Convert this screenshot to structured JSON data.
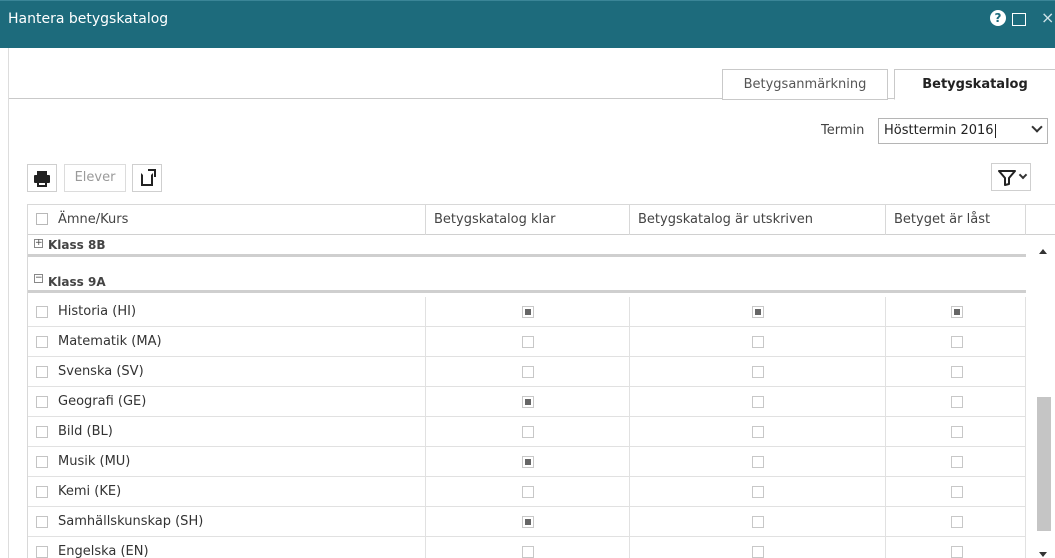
{
  "window": {
    "title": "Hantera betygskatalog",
    "help_icon": "?",
    "close_icon": "×"
  },
  "tabs": [
    {
      "label": "Betygsanmärkning",
      "active": false
    },
    {
      "label": "Betygskatalog",
      "active": true
    }
  ],
  "term": {
    "label": "Termin",
    "value": "Hösttermin 2016"
  },
  "toolbar": {
    "print_icon": "printer-icon",
    "elever_label": "Elever",
    "export_icon": "export-icon",
    "filter_icon": "filter-icon"
  },
  "grid": {
    "columns": [
      "Ämne/Kurs",
      "Betygskatalog klar",
      "Betygskatalog är utskriven",
      "Betyget är låst"
    ],
    "groups": [
      {
        "toggle": "+",
        "label": "Klass 8B",
        "expanded": false
      },
      {
        "toggle": "−",
        "label": "Klass 9A",
        "expanded": true
      }
    ],
    "rows": [
      {
        "name": "Historia (HI)",
        "klar": true,
        "utskriven": true,
        "last": true
      },
      {
        "name": "Matematik (MA)",
        "klar": false,
        "utskriven": false,
        "last": false
      },
      {
        "name": "Svenska (SV)",
        "klar": false,
        "utskriven": false,
        "last": false
      },
      {
        "name": "Geografi (GE)",
        "klar": true,
        "utskriven": false,
        "last": false
      },
      {
        "name": "Bild (BL)",
        "klar": false,
        "utskriven": false,
        "last": false
      },
      {
        "name": "Musik (MU)",
        "klar": true,
        "utskriven": false,
        "last": false
      },
      {
        "name": "Kemi (KE)",
        "klar": false,
        "utskriven": false,
        "last": false
      },
      {
        "name": "Samhällskunskap (SH)",
        "klar": true,
        "utskriven": false,
        "last": false
      },
      {
        "name": "Engelska (EN)",
        "klar": false,
        "utskriven": false,
        "last": false
      }
    ]
  },
  "colors": {
    "titlebar": "#1d6b7c",
    "check_fill": "#666666"
  }
}
